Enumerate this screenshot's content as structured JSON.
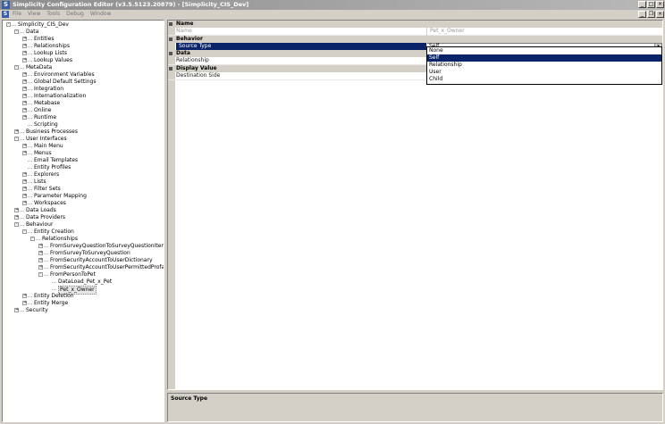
{
  "window": {
    "title": "Simplicity Configuration Editor (v3.5.5123.20879) - [Simplicity_CIS_Dev]",
    "app_icon": "S"
  },
  "menu": [
    "File",
    "View",
    "Tools",
    "Debug",
    "Window"
  ],
  "tree": [
    {
      "label": "Simplicity_CIS_Dev",
      "level": 0,
      "state": "-"
    },
    {
      "label": "Data",
      "level": 1,
      "state": "-"
    },
    {
      "label": "Entities",
      "level": 2,
      "state": "+"
    },
    {
      "label": "Relationships",
      "level": 2,
      "state": "+"
    },
    {
      "label": "Lookup Lists",
      "level": 2,
      "state": "+"
    },
    {
      "label": "Lookup Values",
      "level": 2,
      "state": "+"
    },
    {
      "label": "MetaData",
      "level": 1,
      "state": "-"
    },
    {
      "label": "Environment Variables",
      "level": 2,
      "state": "+"
    },
    {
      "label": "Global Default Settings",
      "level": 2,
      "state": "+"
    },
    {
      "label": "Integration",
      "level": 2,
      "state": "+"
    },
    {
      "label": "Internationalization",
      "level": 2,
      "state": "+"
    },
    {
      "label": "Metabase",
      "level": 2,
      "state": "+"
    },
    {
      "label": "Online",
      "level": 2,
      "state": "+"
    },
    {
      "label": "Runtime",
      "level": 2,
      "state": "+"
    },
    {
      "label": "Scripting",
      "level": 2,
      "state": ""
    },
    {
      "label": "Business Processes",
      "level": 1,
      "state": "+"
    },
    {
      "label": "User Interfaces",
      "level": 1,
      "state": "-"
    },
    {
      "label": "Main Menu",
      "level": 2,
      "state": "+"
    },
    {
      "label": "Menus",
      "level": 2,
      "state": "+"
    },
    {
      "label": "Email Templates",
      "level": 2,
      "state": ""
    },
    {
      "label": "Entity Profiles",
      "level": 2,
      "state": ""
    },
    {
      "label": "Explorers",
      "level": 2,
      "state": "+"
    },
    {
      "label": "Lists",
      "level": 2,
      "state": "+"
    },
    {
      "label": "Filter Sets",
      "level": 2,
      "state": "+"
    },
    {
      "label": "Parameter Mapping",
      "level": 2,
      "state": "+"
    },
    {
      "label": "Workspaces",
      "level": 2,
      "state": "+"
    },
    {
      "label": "Data Loads",
      "level": 1,
      "state": "+"
    },
    {
      "label": "Data Providers",
      "level": 1,
      "state": "+"
    },
    {
      "label": "Behaviour",
      "level": 1,
      "state": "-"
    },
    {
      "label": "Entity Creation",
      "level": 2,
      "state": "-"
    },
    {
      "label": "Relationships",
      "level": 3,
      "state": "-"
    },
    {
      "label": "FromSurveyQuestionToSurveyQuestionItems",
      "level": 4,
      "state": "+"
    },
    {
      "label": "FromSurveyToSurveyQuestion",
      "level": 4,
      "state": "+"
    },
    {
      "label": "FromSecurityAccountToUserDictionary",
      "level": 4,
      "state": "+"
    },
    {
      "label": "FromSecurityAccountToUserPermittedProfanities",
      "level": 4,
      "state": "+"
    },
    {
      "label": "FromPersonToPet",
      "level": 4,
      "state": "-"
    },
    {
      "label": "DataLoad_Pet_x_Pet",
      "level": 5,
      "state": ""
    },
    {
      "label": "Pet_x_Owner",
      "level": 5,
      "state": "",
      "selected": true
    },
    {
      "label": "Entity Deletion",
      "level": 2,
      "state": "+"
    },
    {
      "label": "Entity Merge",
      "level": 2,
      "state": "+"
    },
    {
      "label": "Security",
      "level": 1,
      "state": "+"
    }
  ],
  "grid": {
    "cat_name": "Name",
    "name_label": "Name",
    "name_value": "Pet_x_Owner",
    "cat_behavior": "Behavior",
    "source_type_label": "Source Type",
    "source_type_value": "Self",
    "cat_data": "Data",
    "relationship_label": "Relationship",
    "cat_display": "Display Value",
    "destination_side_label": "Destination Side",
    "dropdown_options": [
      "None",
      "Self",
      "Relationship",
      "User",
      "Child"
    ],
    "dropdown_selected": "Self"
  },
  "help": {
    "title": "Source Type"
  }
}
